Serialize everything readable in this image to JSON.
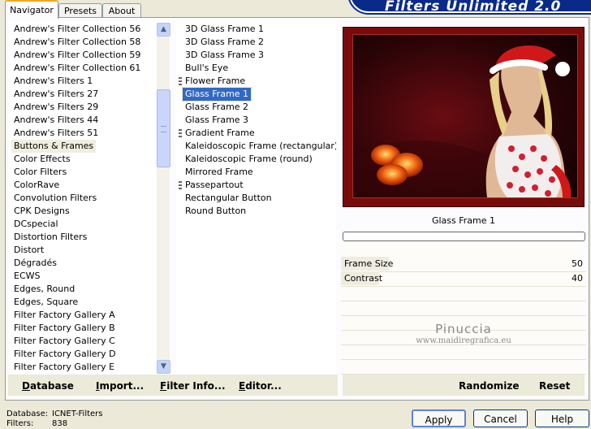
{
  "tabs": [
    "Navigator",
    "Presets",
    "About"
  ],
  "banner_text": "Filters Unlimited 2.0",
  "categories": [
    "Andrew's Filter Collection 56",
    "Andrew's Filter Collection 58",
    "Andrew's Filter Collection 59",
    "Andrew's Filter Collection 61",
    "Andrew's Filters 1",
    "Andrew's Filters 27",
    "Andrew's Filters 29",
    "Andrew's Filters 44",
    "Andrew's Filters 51",
    "Buttons & Frames",
    "Color Effects",
    "Color Filters",
    "ColorRave",
    "Convolution Filters",
    "CPK Designs",
    "DCspecial",
    "Distortion Filters",
    "Distort",
    "Dégradés",
    "ECWS",
    "Edges, Round",
    "Edges, Square",
    "Filter Factory Gallery A",
    "Filter Factory Gallery B",
    "Filter Factory Gallery C",
    "Filter Factory Gallery D",
    "Filter Factory Gallery E"
  ],
  "selected_category": "Buttons & Frames",
  "filters": [
    {
      "label": "3D Glass Frame 1",
      "marked": false
    },
    {
      "label": "3D Glass Frame 2",
      "marked": false
    },
    {
      "label": "3D Glass Frame 3",
      "marked": false
    },
    {
      "label": "Bull's Eye",
      "marked": false
    },
    {
      "label": "Flower Frame",
      "marked": true
    },
    {
      "label": "Glass Frame 1",
      "marked": false
    },
    {
      "label": "Glass Frame 2",
      "marked": false
    },
    {
      "label": "Glass Frame 3",
      "marked": false
    },
    {
      "label": "Gradient Frame",
      "marked": true
    },
    {
      "label": "Kaleidoscopic Frame (rectangular)",
      "marked": false
    },
    {
      "label": "Kaleidoscopic Frame (round)",
      "marked": false
    },
    {
      "label": "Mirrored Frame",
      "marked": false
    },
    {
      "label": "Passepartout",
      "marked": true
    },
    {
      "label": "Rectangular Button",
      "marked": false
    },
    {
      "label": "Round Button",
      "marked": false
    }
  ],
  "selected_filter": "Glass Frame 1",
  "preview": {
    "filter_name": "Glass Frame 1",
    "caption": "Glass Frame 1"
  },
  "sliders": [
    {
      "label": "Frame Size",
      "value": "50",
      "max": 255
    },
    {
      "label": "Contrast",
      "value": "40",
      "max": 255
    }
  ],
  "watermark": {
    "line1": "Pinuccia",
    "line2": "www.maidiregrafica.eu"
  },
  "left_buttons": {
    "database": "Database",
    "import": "Import...",
    "filter_info": "Filter Info...",
    "editor": "Editor..."
  },
  "right_buttons": {
    "randomize": "Randomize",
    "reset": "Reset"
  },
  "status": {
    "database_label": "Database:",
    "database_value": "ICNET-Filters",
    "filters_label": "Filters:",
    "filters_value": "838"
  },
  "dialog_buttons": {
    "apply": "Apply",
    "cancel": "Cancel",
    "help": "Help"
  },
  "colors": {
    "selection": "#3169c6",
    "frame": "#7a0b0b",
    "accent_tab": "#f0a820",
    "banner": "#0a2a8a"
  }
}
